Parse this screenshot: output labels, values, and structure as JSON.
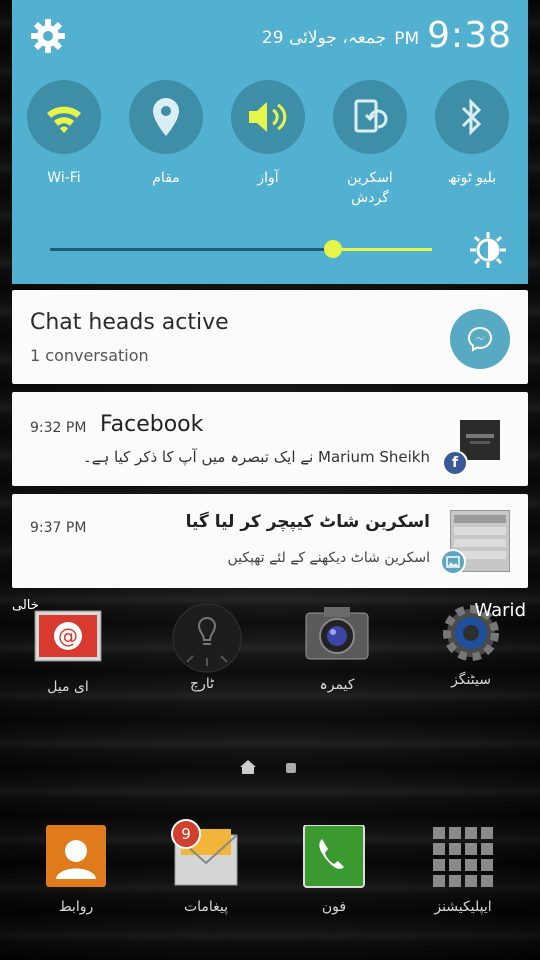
{
  "status": {
    "time": "9:38",
    "ampm": "PM",
    "date": "جمعہ، جولائی 29"
  },
  "quick_settings": {
    "toggles": [
      {
        "label": "Wi-Fi",
        "icon": "wifi-icon",
        "active": true
      },
      {
        "label": "مقام",
        "icon": "location-pin-icon",
        "active": false
      },
      {
        "label": "آواز",
        "icon": "volume-icon",
        "active": true
      },
      {
        "label": "اسکرین گردش",
        "icon": "screen-rotation-icon",
        "active": false
      },
      {
        "label": "بلیو ٹوتھ",
        "icon": "bluetooth-icon",
        "active": false
      }
    ],
    "brightness_level": 0.74,
    "accent_color": "#e6f54a",
    "panel_color": "#52b0d1"
  },
  "notifications": {
    "chat_heads": {
      "title": "Chat heads active",
      "subtitle": "1 conversation",
      "icon": "messenger-icon"
    },
    "facebook": {
      "time": "9:32 PM",
      "title": "Facebook",
      "text": "Marium Sheikh نے ایک تبصرہ میں آپ کا ذکر کیا ہے۔",
      "badge_icon": "facebook-icon"
    },
    "screenshot": {
      "time": "9:37 PM",
      "title": "اسکرین شاٹ کیپچر کر لیا گیا",
      "text": "اسکرین شاٹ دیکھنے کے لئے تھپکیں",
      "badge_icon": "gallery-icon"
    }
  },
  "carriers": {
    "sim1": "خالی",
    "sim2": "Warid"
  },
  "home_apps": [
    {
      "label": "ای میل",
      "icon": "email-icon"
    },
    {
      "label": "ٹارچ",
      "icon": "torch-icon"
    },
    {
      "label": "کیمرہ",
      "icon": "camera-icon"
    },
    {
      "label": "سیٹنگز",
      "icon": "settings-icon"
    }
  ],
  "dock_apps": [
    {
      "label": "روابط",
      "icon": "contacts-icon"
    },
    {
      "label": "پیغامات",
      "icon": "messages-icon",
      "badge": "9"
    },
    {
      "label": "فون",
      "icon": "phone-icon"
    },
    {
      "label": "ایپلیکیشنز",
      "icon": "apps-grid-icon"
    }
  ]
}
